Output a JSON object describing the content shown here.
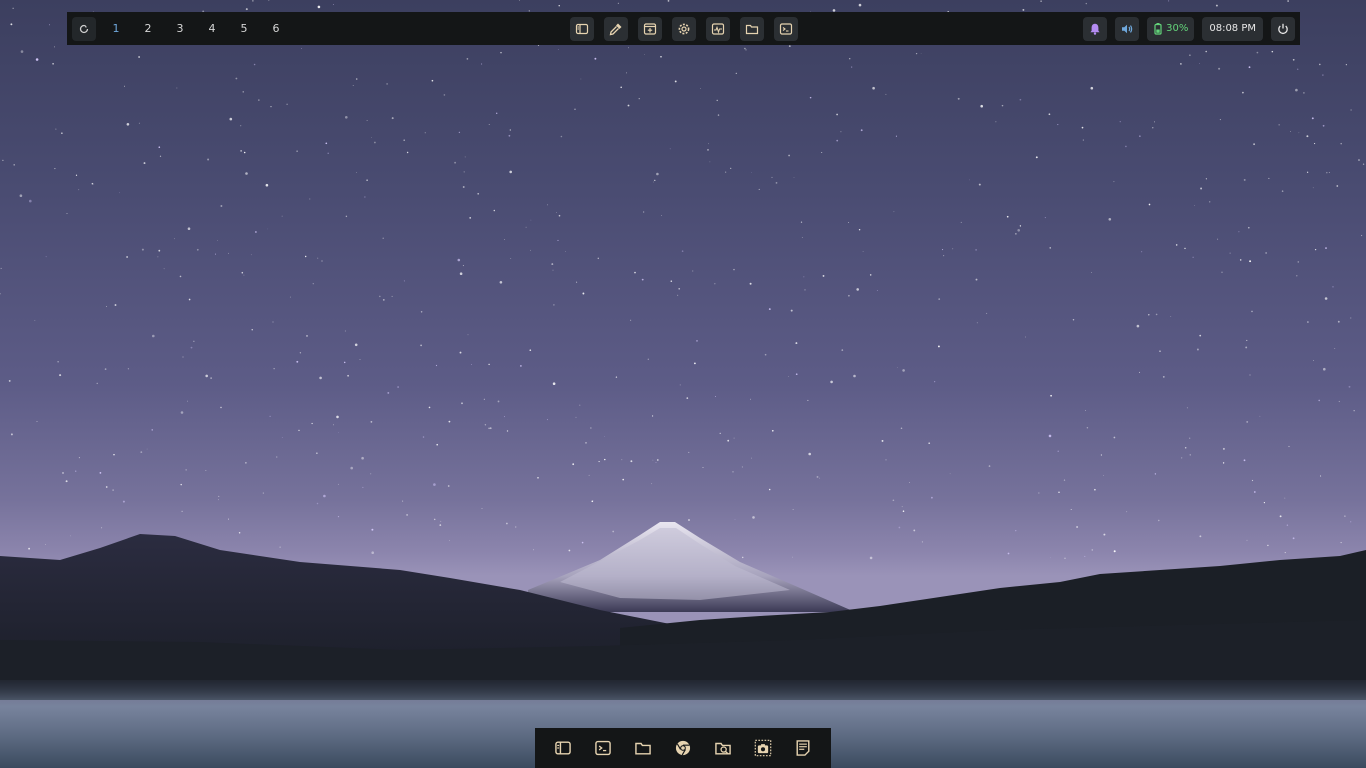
{
  "colors": {
    "bar_bg": "#141617",
    "active_workspace": "#6fa8dc",
    "battery_green": "#63d47a",
    "bell_purple": "#b48cf2",
    "volume_blue": "#6fa8dc",
    "icon_beige": "#e6d3b0"
  },
  "topbar": {
    "launcher_icon": "launcher-swirl-icon",
    "workspaces": [
      "1",
      "2",
      "3",
      "4",
      "5",
      "6"
    ],
    "active_workspace": "1",
    "center_apps": [
      {
        "icon": "sidebar-panel-icon"
      },
      {
        "icon": "color-picker-icon"
      },
      {
        "icon": "add-window-icon"
      },
      {
        "icon": "settings-cog-icon"
      },
      {
        "icon": "system-monitor-icon"
      },
      {
        "icon": "folder-icon"
      },
      {
        "icon": "terminal-icon"
      }
    ],
    "notifications_icon": "bell-icon",
    "volume_icon": "speaker-icon",
    "battery_icon": "battery-icon",
    "battery_text": "30%",
    "clock": "08:08 PM",
    "power_icon": "power-icon"
  },
  "dock": {
    "items": [
      {
        "icon": "sidebar-panel-icon"
      },
      {
        "icon": "terminal-icon"
      },
      {
        "icon": "folder-icon"
      },
      {
        "icon": "browser-icon"
      },
      {
        "icon": "search-files-icon"
      },
      {
        "icon": "screenshot-icon"
      },
      {
        "icon": "notes-icon"
      }
    ]
  }
}
